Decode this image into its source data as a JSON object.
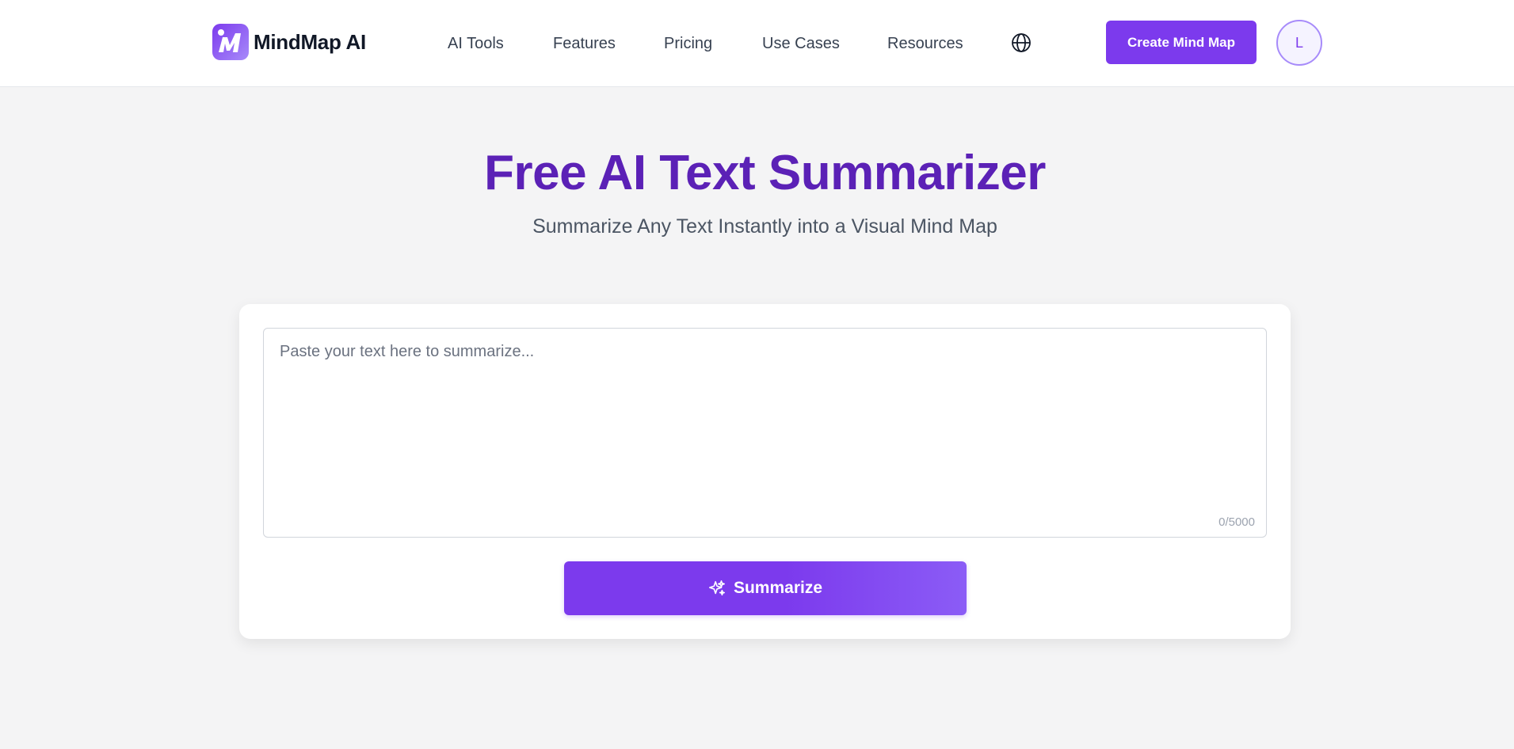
{
  "brand": {
    "name": "MindMap AI",
    "accent": "#7c3aed",
    "title_color": "#5b21b6"
  },
  "nav": {
    "items": [
      {
        "label": "AI Tools"
      },
      {
        "label": "Features"
      },
      {
        "label": "Pricing"
      },
      {
        "label": "Use Cases"
      },
      {
        "label": "Resources"
      }
    ],
    "language_icon": "globe-icon",
    "cta_label": "Create Mind Map",
    "avatar_initial": "L"
  },
  "hero": {
    "title": "Free AI Text Summarizer",
    "subtitle": "Summarize Any Text Instantly into a Visual Mind Map"
  },
  "summarizer": {
    "placeholder": "Paste your text here to summarize...",
    "value": "",
    "counter": "0/5000",
    "button_label": "Summarize",
    "button_icon": "sparkles-icon"
  }
}
